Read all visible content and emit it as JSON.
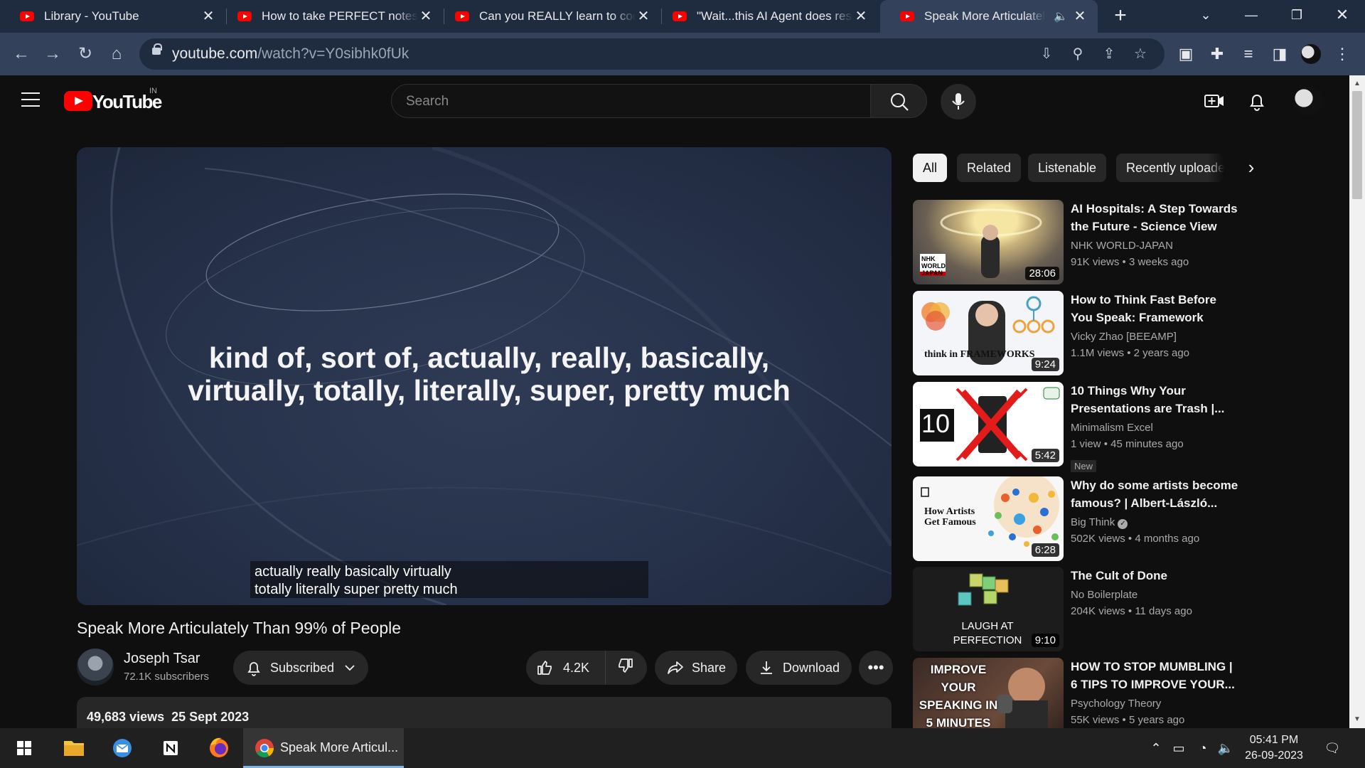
{
  "browser": {
    "tabs": [
      {
        "title": "Library - YouTube"
      },
      {
        "title": "How to take PERFECT notes w"
      },
      {
        "title": "Can you REALLY learn to code"
      },
      {
        "title": "\"Wait...this AI Agent does rese"
      },
      {
        "title": "Speak More Articulately T"
      }
    ],
    "url_host": "youtube.com",
    "url_path": "/watch?v=Y0sibhk0fUk"
  },
  "youtube": {
    "region": "IN",
    "logo_text": "YouTube",
    "search_placeholder": "Search"
  },
  "video": {
    "slide_line1": "kind of, sort of, actually, really, basically,",
    "slide_line2": "virtually, totally, literally, super, pretty much",
    "caption_line1": "actually really basically virtually",
    "caption_line2": "totally literally super pretty much",
    "title": "Speak More Articulately Than 99% of People",
    "channel": "Joseph Tsar",
    "subscribers": "72.1K subscribers",
    "subscribe_label": "Subscribed",
    "likes": "4.2K",
    "share_label": "Share",
    "download_label": "Download",
    "views": "49,683 views",
    "date": "25 Sept 2023"
  },
  "chips": [
    {
      "label": "All"
    },
    {
      "label": "Related"
    },
    {
      "label": "Listenable"
    },
    {
      "label": "Recently uploaded"
    }
  ],
  "recommendations": [
    {
      "title": "AI Hospitals: A Step Towards the Future - Science View",
      "channel": "NHK WORLD-JAPAN",
      "views": "91K views",
      "age": "3 weeks ago",
      "duration": "28:06",
      "thumb_text": "NHK WORLD JAPAN"
    },
    {
      "title": "How to Think Fast Before You Speak: Framework Thinking",
      "channel": "Vicky Zhao [BEEAMP]",
      "views": "1.1M views",
      "age": "2 years ago",
      "duration": "9:24",
      "thumb_text": "think in FRAMEWORKS"
    },
    {
      "title": "10 Things Why Your Presentations are Trash |...",
      "channel": "Minimalism Excel",
      "views": "1 view",
      "age": "45 minutes ago",
      "duration": "5:42",
      "badge": "New",
      "thumb_text": "10"
    },
    {
      "title": "Why do some artists become famous? | Albert-László...",
      "channel": "Big Think",
      "views": "502K views",
      "age": "4 months ago",
      "duration": "6:28",
      "thumb_text": "How Artists Get Famous"
    },
    {
      "title": "The Cult of Done",
      "channel": "No Boilerplate",
      "views": "204K views",
      "age": "11 days ago",
      "duration": "9:10",
      "thumb_text": "LAUGH AT PERFECTION"
    },
    {
      "title": "HOW TO STOP MUMBLING | 6 TIPS TO IMPROVE YOUR...",
      "channel": "Psychology Theory",
      "views": "55K views",
      "age": "5 years ago",
      "duration": "",
      "thumb_text": "IMPROVE YOUR SPEAKING IN 5 MINUTES"
    }
  ],
  "taskbar": {
    "chrome_label": "Speak More Articul...",
    "time": "05:41 PM",
    "date": "26-09-2023"
  }
}
